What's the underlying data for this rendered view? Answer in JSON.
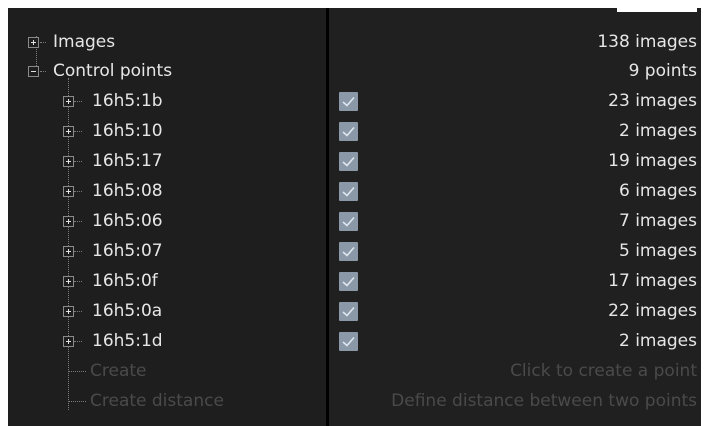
{
  "tree": {
    "images": {
      "label": "Images",
      "count": "138 images"
    },
    "control_points": {
      "label": "Control points",
      "count": "9 points",
      "items": [
        {
          "id": "16h5:1b",
          "checked": true,
          "count": "23 images"
        },
        {
          "id": "16h5:10",
          "checked": true,
          "count": "2 images"
        },
        {
          "id": "16h5:17",
          "checked": true,
          "count": "19 images"
        },
        {
          "id": "16h5:08",
          "checked": true,
          "count": "6 images"
        },
        {
          "id": "16h5:06",
          "checked": true,
          "count": "7 images"
        },
        {
          "id": "16h5:07",
          "checked": true,
          "count": "5 images"
        },
        {
          "id": "16h5:0f",
          "checked": true,
          "count": "17 images"
        },
        {
          "id": "16h5:0a",
          "checked": true,
          "count": "22 images"
        },
        {
          "id": "16h5:1d",
          "checked": true,
          "count": "2 images"
        }
      ],
      "create": {
        "label": "Create",
        "hint": "Click to create a point"
      },
      "create_distance": {
        "label": "Create distance",
        "hint": "Define distance between two points"
      }
    }
  },
  "colors": {
    "background": "#1e1e1e",
    "text": "#e6e6e6",
    "disabled_text": "#4a4a4a",
    "checkbox": "#8a98a8"
  }
}
